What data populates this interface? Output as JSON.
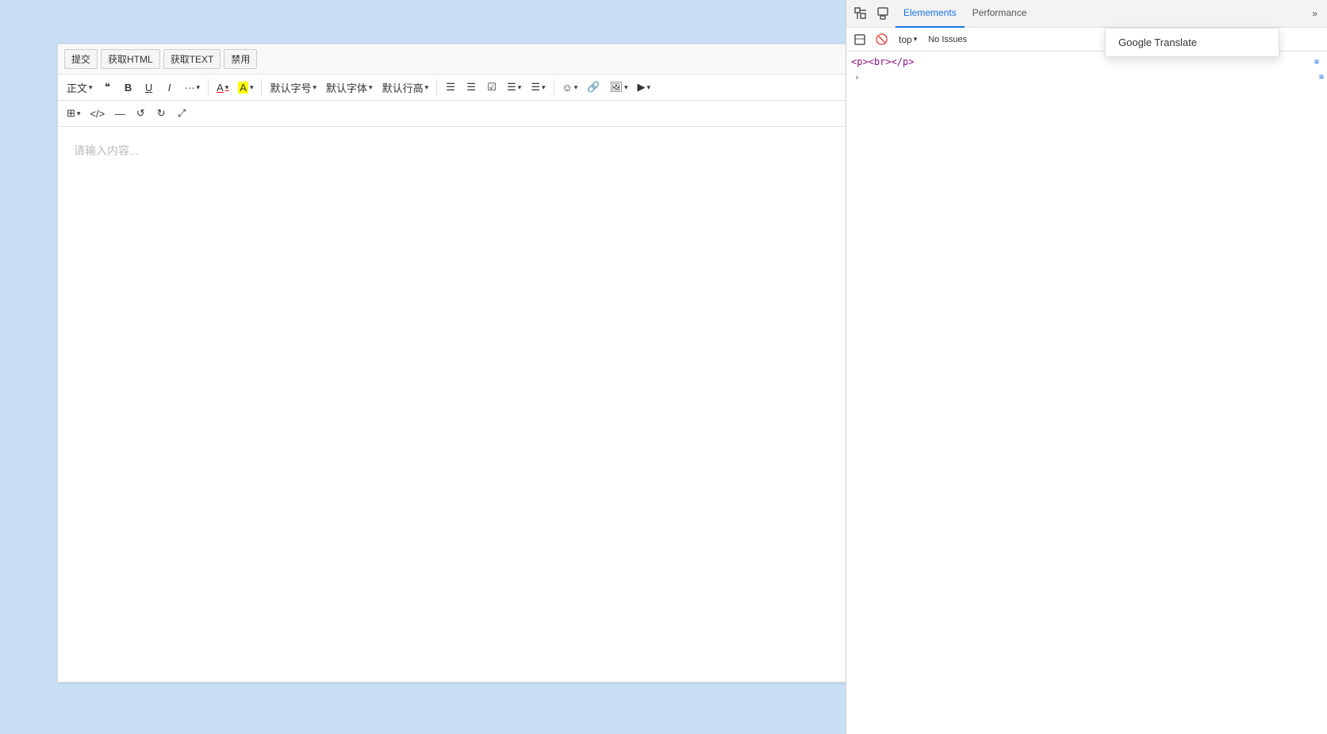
{
  "topButtons": {
    "submit": "提交",
    "getHTML": "获取HTML",
    "getText": "获取TEXT",
    "disable": "禁用"
  },
  "toolbar": {
    "textStyle": "正文",
    "bold": "B",
    "underline": "U",
    "italic": "I",
    "more": "···",
    "fontColor": "A",
    "bgColor": "A",
    "fontSize": "默认字号",
    "fontFamily": "默认字体",
    "lineHeight": "默认行高",
    "bulletList": "≡",
    "orderedList": "≡",
    "todoList": "☑",
    "align": "≡",
    "indent": "≡",
    "emoji": "☺",
    "link": "🔗",
    "image": "🖼",
    "video": "▶"
  },
  "toolbar2": {
    "table": "⊞",
    "code": "</>",
    "clearFormat": "—",
    "undo": "↺",
    "redo": "↻",
    "fullscreen": "⤢"
  },
  "editor": {
    "placeholder": "请输入内容..."
  },
  "devtools": {
    "tabs": [
      {
        "label": "Elem",
        "active": true
      },
      {
        "label": "Performance",
        "active": false
      }
    ],
    "moreLabel": "»",
    "topLabel": "top",
    "secondaryIcons": [
      "⊞",
      "🚫"
    ],
    "noIssues": "No Issues",
    "htmlCode": "<p><br></p>",
    "expandArrow": "›",
    "googleTranslate": "Google Translate",
    "rightIndicator1": "≡",
    "rightIndicator2": "≡"
  }
}
